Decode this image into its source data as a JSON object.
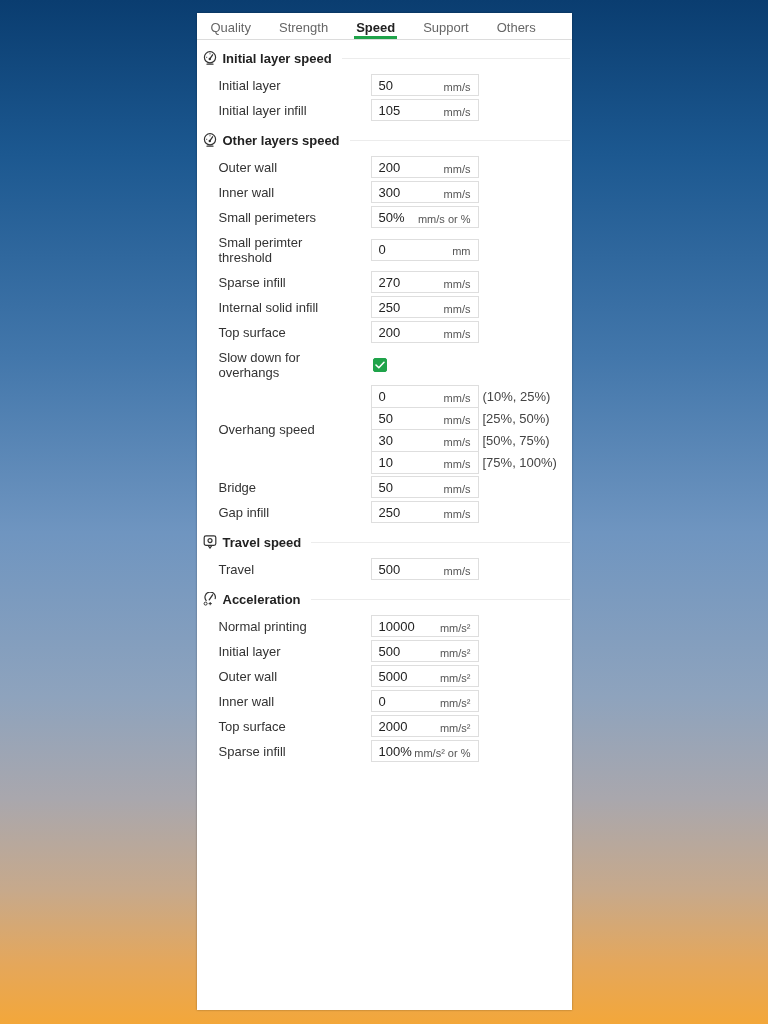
{
  "tabs": [
    {
      "label": "Quality",
      "selected": false
    },
    {
      "label": "Strength",
      "selected": false
    },
    {
      "label": "Speed",
      "selected": true
    },
    {
      "label": "Support",
      "selected": false
    },
    {
      "label": "Others",
      "selected": false
    }
  ],
  "sections": [
    {
      "title": "Initial layer speed",
      "kind": "speed",
      "rows": [
        {
          "kind": "field",
          "label": "Initial layer",
          "value": "50",
          "unit": "mm/s"
        },
        {
          "kind": "field",
          "label": "Initial layer infill",
          "value": "105",
          "unit": "mm/s"
        }
      ]
    },
    {
      "title": "Other layers speed",
      "kind": "speed",
      "rows": [
        {
          "kind": "field",
          "label": "Outer wall",
          "value": "200",
          "unit": "mm/s"
        },
        {
          "kind": "field",
          "label": "Inner wall",
          "value": "300",
          "unit": "mm/s"
        },
        {
          "kind": "field",
          "label": "Small perimeters",
          "value": "50%",
          "unit": "mm/s or %"
        },
        {
          "kind": "field",
          "label": "Small perimter threshold",
          "value": "0",
          "unit": "mm"
        },
        {
          "kind": "field",
          "label": "Sparse infill",
          "value": "270",
          "unit": "mm/s"
        },
        {
          "kind": "field",
          "label": "Internal solid infill",
          "value": "250",
          "unit": "mm/s"
        },
        {
          "kind": "field",
          "label": "Top surface",
          "value": "200",
          "unit": "mm/s"
        },
        {
          "kind": "checkbox",
          "label": "Slow down for overhangs",
          "checked": true
        },
        {
          "kind": "multi",
          "label": "Overhang speed",
          "fields": [
            {
              "value": "0",
              "unit": "mm/s",
              "range": "(10%, 25%)"
            },
            {
              "value": "50",
              "unit": "mm/s",
              "range": "[25%, 50%)"
            },
            {
              "value": "30",
              "unit": "mm/s",
              "range": "[50%, 75%)"
            },
            {
              "value": "10",
              "unit": "mm/s",
              "range": "[75%, 100%)"
            }
          ]
        },
        {
          "kind": "field",
          "label": "Bridge",
          "value": "50",
          "unit": "mm/s"
        },
        {
          "kind": "field",
          "label": "Gap infill",
          "value": "250",
          "unit": "mm/s"
        }
      ]
    },
    {
      "title": "Travel speed",
      "kind": "travel",
      "rows": [
        {
          "kind": "field",
          "label": "Travel",
          "value": "500",
          "unit": "mm/s"
        }
      ]
    },
    {
      "title": "Acceleration",
      "kind": "acceleration",
      "rows": [
        {
          "kind": "field",
          "label": "Normal printing",
          "value": "10000",
          "unit": "mm/s²"
        },
        {
          "kind": "field",
          "label": "Initial layer",
          "value": "500",
          "unit": "mm/s²"
        },
        {
          "kind": "field",
          "label": "Outer wall",
          "value": "5000",
          "unit": "mm/s²"
        },
        {
          "kind": "field",
          "label": "Inner wall",
          "value": "0",
          "unit": "mm/s²"
        },
        {
          "kind": "field",
          "label": "Top surface",
          "value": "2000",
          "unit": "mm/s²"
        },
        {
          "kind": "field",
          "label": "Sparse infill",
          "value": "100%",
          "unit": "mm/s² or %"
        }
      ]
    }
  ]
}
